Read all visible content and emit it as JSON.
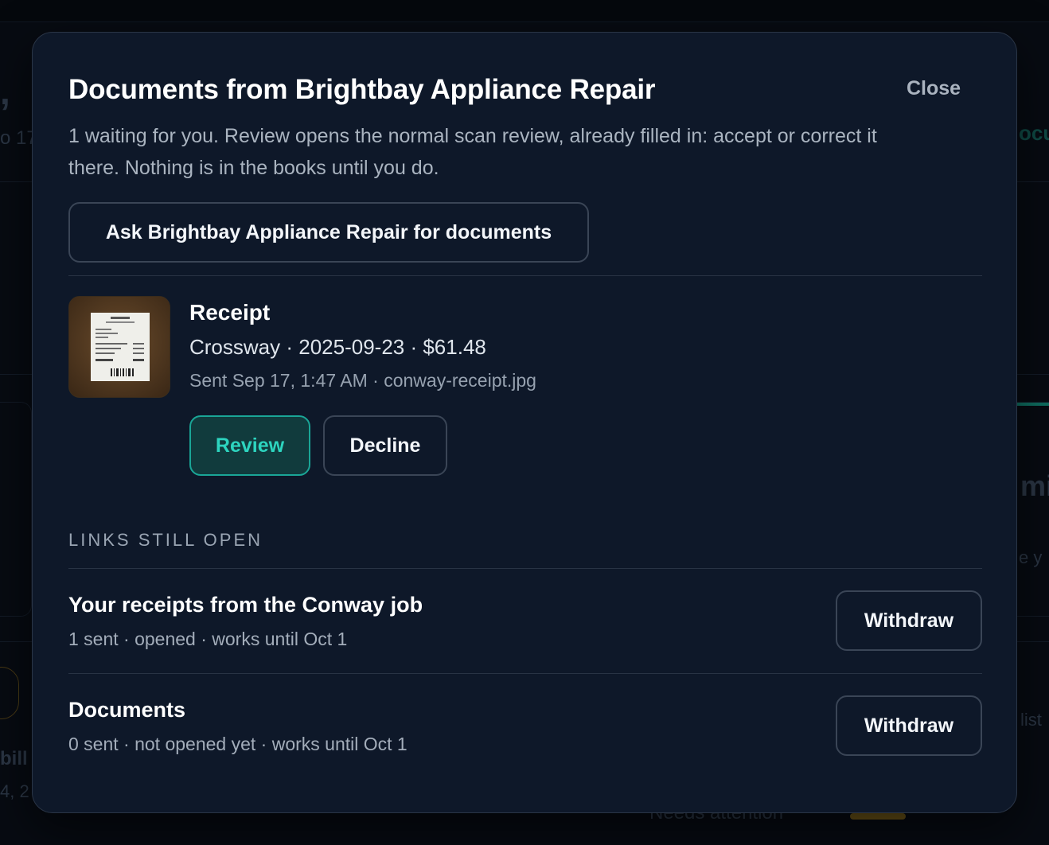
{
  "background": {
    "fragments": [
      ",",
      "o 17",
      "ocu",
      "mi",
      "e y",
      "list",
      "bill",
      "4, 2",
      "Needs attention"
    ]
  },
  "modal": {
    "title": "Documents from Brightbay Appliance Repair",
    "close_label": "Close",
    "intro": "1 waiting for you. Review opens the normal scan review, already filled in: accept or correct it there. Nothing is in the books until you do.",
    "ask_button": "Ask Brightbay Appliance Repair for documents",
    "document": {
      "type": "Receipt",
      "details": "Crossway · 2025-09-23 · $61.48",
      "sent": "Sent Sep 17, 1:47 AM · conway-receipt.jpg",
      "thumbnail_icon": "receipt-photo-icon",
      "review_label": "Review",
      "decline_label": "Decline"
    },
    "links_section_label": "LINKS STILL OPEN",
    "links": [
      {
        "title": "Your receipts from the Conway job",
        "meta": "1 sent · opened · works until Oct 1",
        "withdraw_label": "Withdraw"
      },
      {
        "title": "Documents",
        "meta": "0 sent · not opened yet · works until Oct 1",
        "withdraw_label": "Withdraw"
      }
    ]
  },
  "colors": {
    "modal_bg": "#0e1829",
    "accent": "#2dd4bf",
    "border": "#3a4556"
  }
}
